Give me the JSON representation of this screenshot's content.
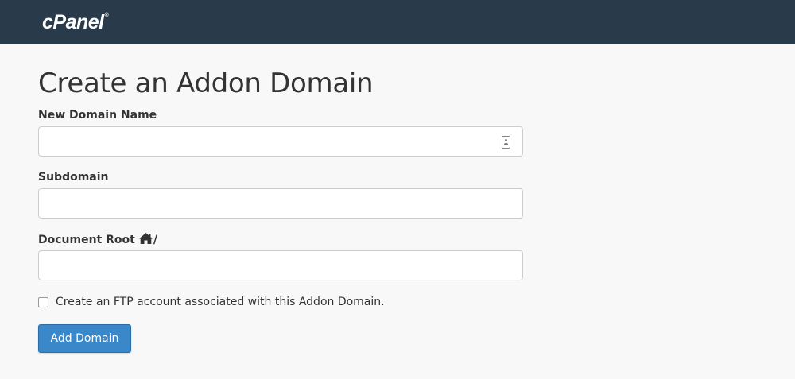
{
  "header": {
    "logo": "cPanel",
    "logo_mark": "®"
  },
  "page": {
    "title": "Create an Addon Domain"
  },
  "form": {
    "new_domain": {
      "label": "New Domain Name",
      "value": ""
    },
    "subdomain": {
      "label": "Subdomain",
      "value": ""
    },
    "document_root": {
      "label": "Document Root",
      "suffix": "/",
      "value": ""
    },
    "ftp_checkbox": {
      "label": "Create an FTP account associated with this Addon Domain.",
      "checked": false
    },
    "submit": {
      "label": "Add Domain"
    }
  },
  "colors": {
    "topbar": "#293a4a",
    "primary_button": "#3a87c9",
    "background": "#f8f8f8"
  }
}
